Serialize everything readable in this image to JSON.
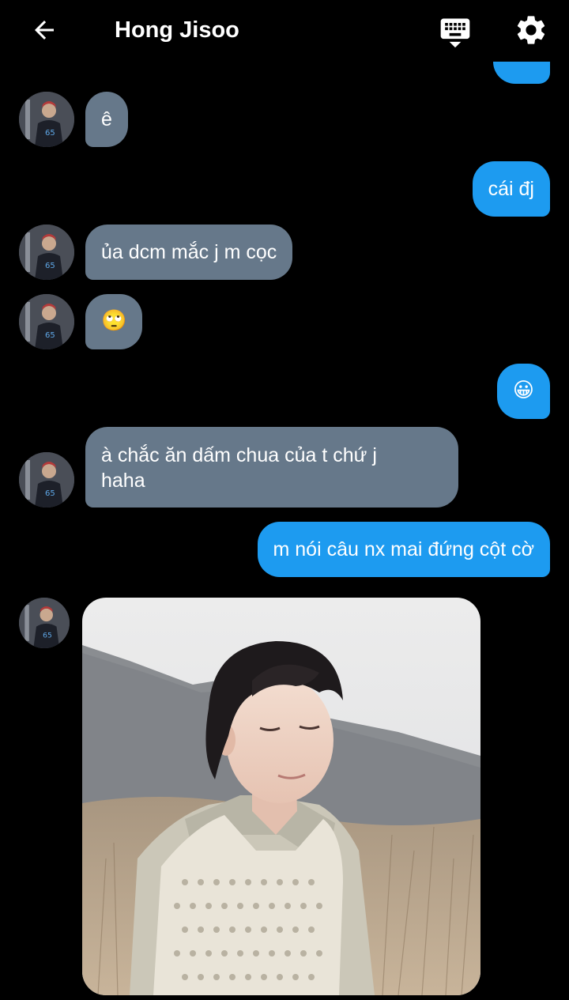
{
  "header": {
    "title": "Hong Jisoo",
    "back_icon": "arrow-left-icon",
    "keyboard_icon": "keyboard-icon",
    "settings_icon": "gear-icon"
  },
  "colors": {
    "background": "#000000",
    "incoming_bubble": "#66788a",
    "outgoing_bubble": "#1d9bf0",
    "text": "#ffffff"
  },
  "messages": [
    {
      "direction": "out",
      "text": ""
    },
    {
      "direction": "in",
      "text": "ê"
    },
    {
      "direction": "out",
      "text": "cái đj"
    },
    {
      "direction": "in",
      "text": "ủa dcm mắc j m cọc"
    },
    {
      "direction": "in",
      "text": "🙄"
    },
    {
      "direction": "out",
      "text": "😀"
    },
    {
      "direction": "in",
      "line1": "à chắc ăn dấm chua của t chứ j",
      "line2": "haha"
    },
    {
      "direction": "out",
      "text": "m nói câu nx mai đứng cột cờ"
    },
    {
      "direction": "in",
      "type": "image",
      "image_icon": "photo-of-person-in-field"
    }
  ]
}
